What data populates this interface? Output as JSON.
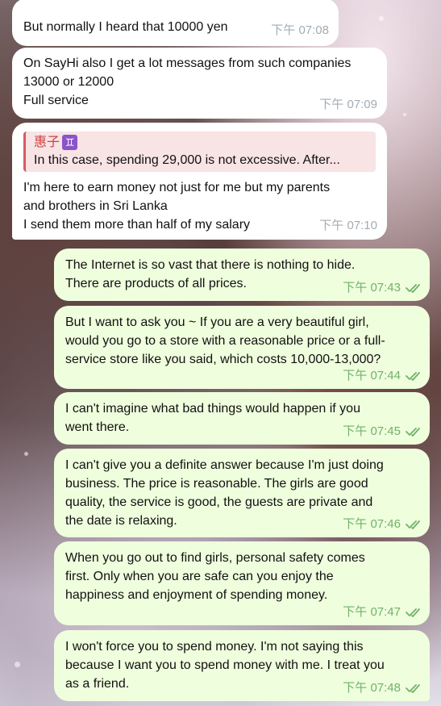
{
  "messages": [
    {
      "text_lines": [
        "But normally I heard that 10000 yen"
      ],
      "time": "下午 07:08"
    },
    {
      "text_lines": [
        "On SayHi also I get a lot messages from such companies",
        "13000 or 12000",
        "Full service"
      ],
      "time": "下午 07:09"
    },
    {
      "reply": {
        "author": "惠子",
        "author_badge": "♊",
        "text": "In this case, spending 29,000 is not excessive. After..."
      },
      "text_lines": [
        "I'm here to earn money not just for me but my parents",
        "and brothers in Sri Lanka",
        "I send them more than half of my salary"
      ],
      "time": "下午 07:10"
    },
    {
      "text_lines": [
        "The Internet is so vast that there is nothing to hide.",
        "There are products of all prices."
      ],
      "time": "下午 07:43"
    },
    {
      "text_lines": [
        "But I want to ask you ~ If you are a very beautiful girl,",
        "would you go to a store with a reasonable price or a full-",
        "service store like you said, which costs 10,000-13,000?"
      ],
      "time": "下午 07:44"
    },
    {
      "text_lines": [
        "I can't imagine what bad things would happen if you",
        "went there."
      ],
      "time": "下午 07:45"
    },
    {
      "text_lines": [
        "I can't give you a definite answer because I'm just doing",
        "business. The price is reasonable. The girls are good",
        "quality, the service is good, the guests are private and",
        "the date is relaxing."
      ],
      "time": "下午 07:46"
    },
    {
      "text_lines": [
        "When you go out to find girls, personal safety comes",
        "first. Only when you are safe can you enjoy the",
        "happiness and enjoyment of spending money."
      ],
      "time": "下午 07:47"
    },
    {
      "text_lines": [
        "I won't force you to spend money. I'm not saying this",
        "because I want you to spend money with me. I treat you",
        "as a friend."
      ],
      "time": "下午 07:48"
    }
  ],
  "colors": {
    "incoming_bg": "#ffffff",
    "outgoing_bg": "#effedd",
    "time_in": "#a3acb3",
    "time_out": "#71b26a",
    "reply_accent": "#d35c63"
  }
}
